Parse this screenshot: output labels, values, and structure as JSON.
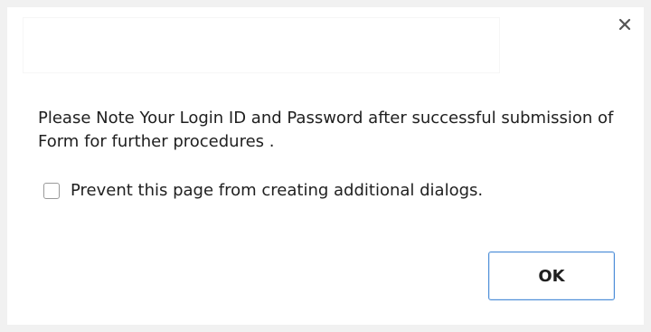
{
  "dialog": {
    "message": "Please Note Your Login ID and Password after successful submission of Form for further procedures .",
    "prevent_label": "Prevent this page from creating additional dialogs.",
    "prevent_checked": false,
    "ok_label": "OK",
    "close_icon": "close-icon",
    "colors": {
      "button_border": "#4d8ed8",
      "text": "#202020",
      "frame": "#f1f1f1"
    }
  }
}
